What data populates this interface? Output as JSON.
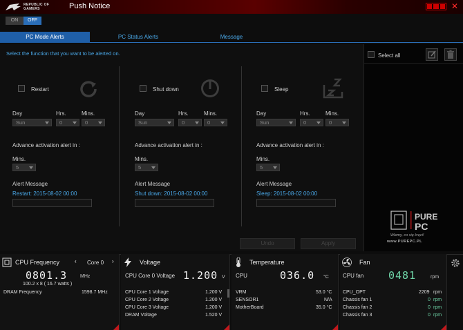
{
  "titlebar": {
    "brand_line1": "REPUBLIC OF",
    "brand_line2": "GAMERS",
    "title": "Push Notice",
    "close": "✕"
  },
  "toggle": {
    "on_label": "ON",
    "off_label": "OFF",
    "state": "OFF"
  },
  "tabs": [
    {
      "label": "PC Mode Alerts",
      "active": true
    },
    {
      "label": "PC Status Alerts",
      "active": false
    },
    {
      "label": "Message",
      "active": false
    }
  ],
  "hint": "Select the function that you want to be alerted on.",
  "alerts": [
    {
      "name": "Restart",
      "icon": "restart-icon",
      "day_label": "Day",
      "hrs_label": "Hrs.",
      "mins_label": "Mins.",
      "day": "Sun",
      "hrs": "0",
      "mins": "0",
      "advance_label": "Advance activation alert in :",
      "adv_mins_label": "Mins.",
      "adv_mins": "5",
      "msg_label": "Alert Message",
      "msg_value": "Restart: 2015-08-02 00:00"
    },
    {
      "name": "Shut down",
      "icon": "power-icon",
      "day_label": "Day",
      "hrs_label": "Hrs.",
      "mins_label": "Mins.",
      "day": "Sun",
      "hrs": "0",
      "mins": "0",
      "advance_label": "Advance activation alert in :",
      "adv_mins_label": "Mins.",
      "adv_mins": "5",
      "msg_label": "Alert Message",
      "msg_value": "Shut down: 2015-08-02 00:00"
    },
    {
      "name": "Sleep",
      "icon": "sleep-icon",
      "day_label": "Day",
      "hrs_label": "Hrs.",
      "mins_label": "Mins.",
      "day": "Sun",
      "hrs": "0",
      "mins": "0",
      "advance_label": "Advance activation alert in :",
      "adv_mins_label": "Mins.",
      "adv_mins": "5",
      "msg_label": "Alert Message",
      "msg_value": "Sleep: 2015-08-02 00:00"
    }
  ],
  "right_panel": {
    "select_all": "Select all"
  },
  "buttons": {
    "undo": "Undo",
    "apply": "Apply"
  },
  "watermark": {
    "tagline": "Wiemy, co się kręci!",
    "url": "www.PUREPC.PL",
    "logo_top": "PURE",
    "logo_bottom": "PC"
  },
  "monitor": {
    "cpu_freq": {
      "title": "CPU Frequency",
      "core_select": "Core 0",
      "value": "0801.3",
      "unit": "MHz",
      "multiplier": "100.2  x  8   ( 16.7   watts )",
      "dram_label": "DRAM Frequency",
      "dram_value": "1598.7  MHz"
    },
    "voltage": {
      "title": "Voltage",
      "main_label": "CPU Core 0 Voltage",
      "main_value": "1.200",
      "main_unit": "V",
      "rows": [
        {
          "label": "CPU Core 1 Voltage",
          "value": "1.200  V"
        },
        {
          "label": "CPU Core 2 Voltage",
          "value": "1.200  V"
        },
        {
          "label": "CPU Core 3 Voltage",
          "value": "1.200  V"
        },
        {
          "label": "DRAM Voltage",
          "value": "1.520  V"
        }
      ]
    },
    "temperature": {
      "title": "Temperature",
      "main_label": "CPU",
      "main_value": "036.0",
      "main_unit": "°C",
      "rows": [
        {
          "label": "VRM",
          "value": "53.0 °C"
        },
        {
          "label": "SENSOR1",
          "value": "N/A"
        },
        {
          "label": "MotherBoard",
          "value": "35.0 °C"
        }
      ]
    },
    "fan": {
      "title": "Fan",
      "main_label": "CPU fan",
      "main_value": "0481",
      "main_unit": "rpm",
      "rows": [
        {
          "label": "CPU_OPT",
          "value": "2209",
          "unit": "rpm"
        },
        {
          "label": "Chassis fan 1",
          "value": "0",
          "unit": "rpm"
        },
        {
          "label": "Chassis fan 2",
          "value": "0",
          "unit": "rpm"
        },
        {
          "label": "Chassis fan 3",
          "value": "0",
          "unit": "rpm"
        }
      ]
    }
  },
  "colors": {
    "accent_blue": "#2a6eb8",
    "link_blue": "#4aa8e8",
    "rog_red": "#c0181c",
    "fan_green": "#6fd5a8"
  }
}
